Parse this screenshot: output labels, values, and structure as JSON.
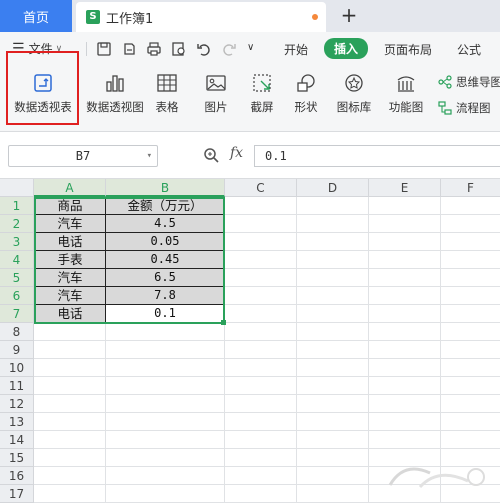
{
  "tabs": {
    "home": "首页",
    "document": "工作簿1",
    "doc_icon_letter": "S",
    "add": "+"
  },
  "menu": {
    "file": "文件",
    "tabs": [
      "开始",
      "插入",
      "页面布局",
      "公式"
    ],
    "active_tab": "插入"
  },
  "ribbon": {
    "items": [
      {
        "label": "数据透视表",
        "icon": "pivot-table-icon"
      },
      {
        "label": "数据透视图",
        "icon": "pivot-chart-icon"
      },
      {
        "label": "表格",
        "icon": "table-icon"
      },
      {
        "label": "图片",
        "icon": "picture-icon"
      },
      {
        "label": "截屏",
        "icon": "screenshot-icon"
      },
      {
        "label": "形状",
        "icon": "shapes-icon"
      },
      {
        "label": "图标库",
        "icon": "icon-library-icon"
      },
      {
        "label": "功能图",
        "icon": "function-chart-icon"
      }
    ],
    "side_items": [
      "思维导图",
      "流程图"
    ]
  },
  "formula_bar": {
    "cell_ref": "B7",
    "fx": "fx",
    "value": "0.1"
  },
  "grid": {
    "columns": [
      "A",
      "B",
      "C",
      "D",
      "E",
      "F"
    ],
    "rows": [
      "1",
      "2",
      "3",
      "4",
      "5",
      "6",
      "7",
      "8",
      "9",
      "10",
      "11",
      "12",
      "13",
      "14",
      "15",
      "16",
      "17"
    ],
    "headers": [
      "商品",
      "金额（万元）"
    ],
    "data": [
      [
        "汽车",
        "4.5"
      ],
      [
        "电话",
        "0.05"
      ],
      [
        "手表",
        "0.45"
      ],
      [
        "汽车",
        "6.5"
      ],
      [
        "汽车",
        "7.8"
      ],
      [
        "电话",
        "0.1"
      ]
    ]
  },
  "colors": {
    "accent_green": "#2aa15b",
    "tab_blue": "#3b7ff0",
    "highlight_red": "#e02020"
  }
}
